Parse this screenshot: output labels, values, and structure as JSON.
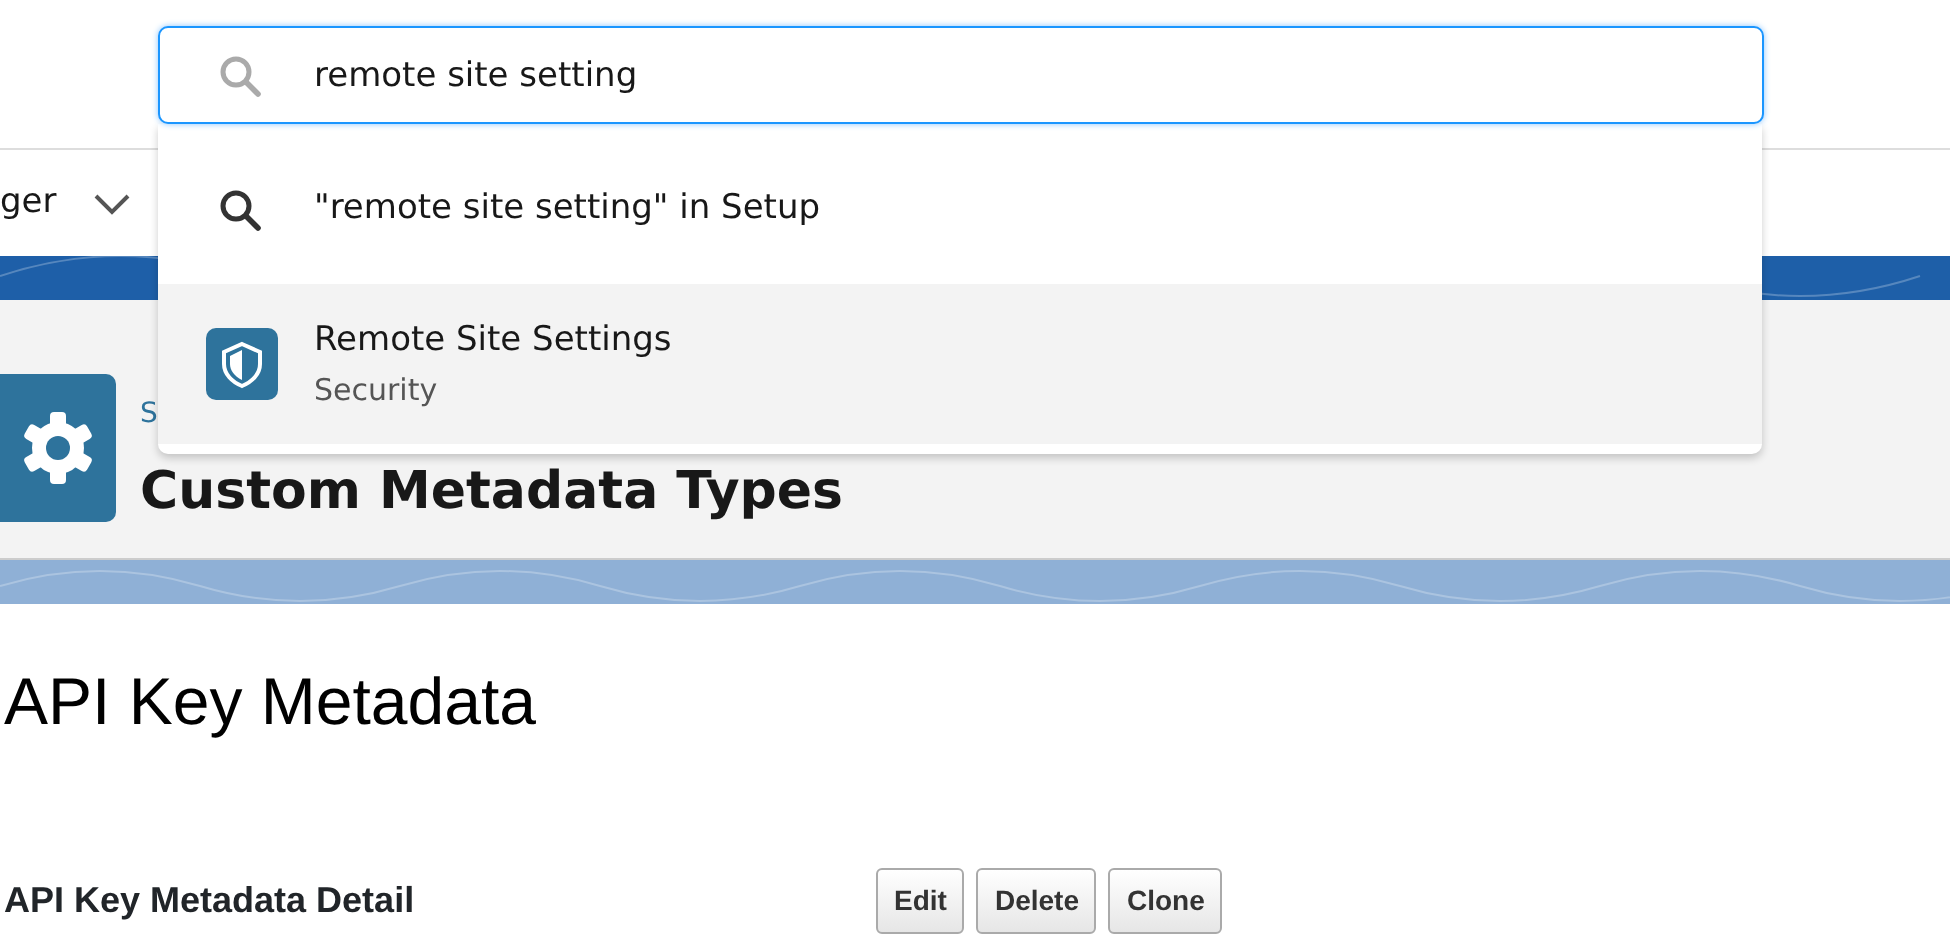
{
  "search": {
    "value": "remote site setting"
  },
  "nav": {
    "label": "ger"
  },
  "header": {
    "breadcrumb": "S",
    "title": "Custom Metadata Types"
  },
  "dropdown": [
    {
      "kind": "query",
      "label": "\"remote site setting\" in Setup",
      "selected": false
    },
    {
      "kind": "result",
      "label": "Remote Site Settings",
      "sublabel": "Security",
      "selected": true
    }
  ],
  "record": {
    "title": "API Key Metadata",
    "detail_title": "API Key Metadata Detail",
    "buttons": [
      "Edit",
      "Delete",
      "Clone"
    ]
  }
}
